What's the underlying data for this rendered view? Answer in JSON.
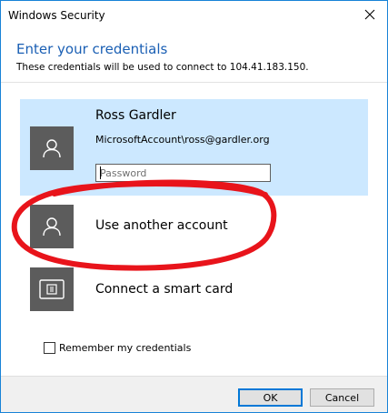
{
  "window": {
    "title": "Windows Security",
    "close_icon": "close-icon",
    "border_color": "#1883d7"
  },
  "header": {
    "heading": "Enter your credentials",
    "description": "These credentials will be used to connect to 104.41.183.150."
  },
  "selected_account": {
    "name": "Ross Gardler",
    "account": "MicrosoftAccount\\ross@gardler.org",
    "password_placeholder": "Password",
    "password_value": "",
    "avatar_icon": "user-icon",
    "highlight_color": "#cce8ff"
  },
  "options": [
    {
      "label": "Use another account",
      "icon": "user-icon"
    },
    {
      "label": "Connect a smart card",
      "icon": "smart-card-icon"
    }
  ],
  "remember": {
    "label": "Remember my credentials",
    "checked": false
  },
  "buttons": {
    "ok": "OK",
    "cancel": "Cancel"
  },
  "annotation": {
    "shape": "hand-drawn red circle around 'Use another account'",
    "color": "#e8141b"
  }
}
